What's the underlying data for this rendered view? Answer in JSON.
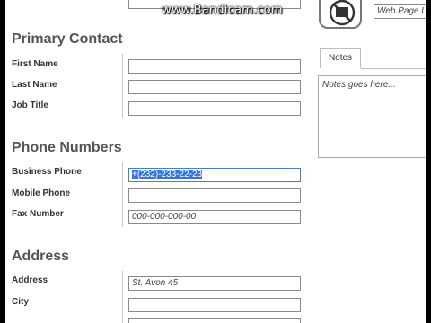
{
  "watermark": "www.Bandicam.com",
  "sections": {
    "primary_contact": "Primary Contact",
    "phone_numbers": "Phone Numbers",
    "address": "Address"
  },
  "fields": {
    "first_name": {
      "label": "First Name",
      "value": ""
    },
    "last_name": {
      "label": "Last Name",
      "value": ""
    },
    "job_title": {
      "label": "Job Title",
      "value": ""
    },
    "business_phone": {
      "label": "Business Phone",
      "value": "+(232)-233-22-23"
    },
    "mobile_phone": {
      "label": "Mobile Phone",
      "value": ""
    },
    "fax_number": {
      "label": "Fax Number",
      "value": "000-000-000-00"
    },
    "address": {
      "label": "Address",
      "value": "St. Avon 45"
    },
    "city": {
      "label": "City",
      "value": ""
    }
  },
  "web_page": {
    "placeholder": "Web Page U"
  },
  "notes": {
    "tab_label": "Notes",
    "placeholder": "Notes goes here..."
  },
  "icons": [
    "image-placeholder-icon"
  ]
}
